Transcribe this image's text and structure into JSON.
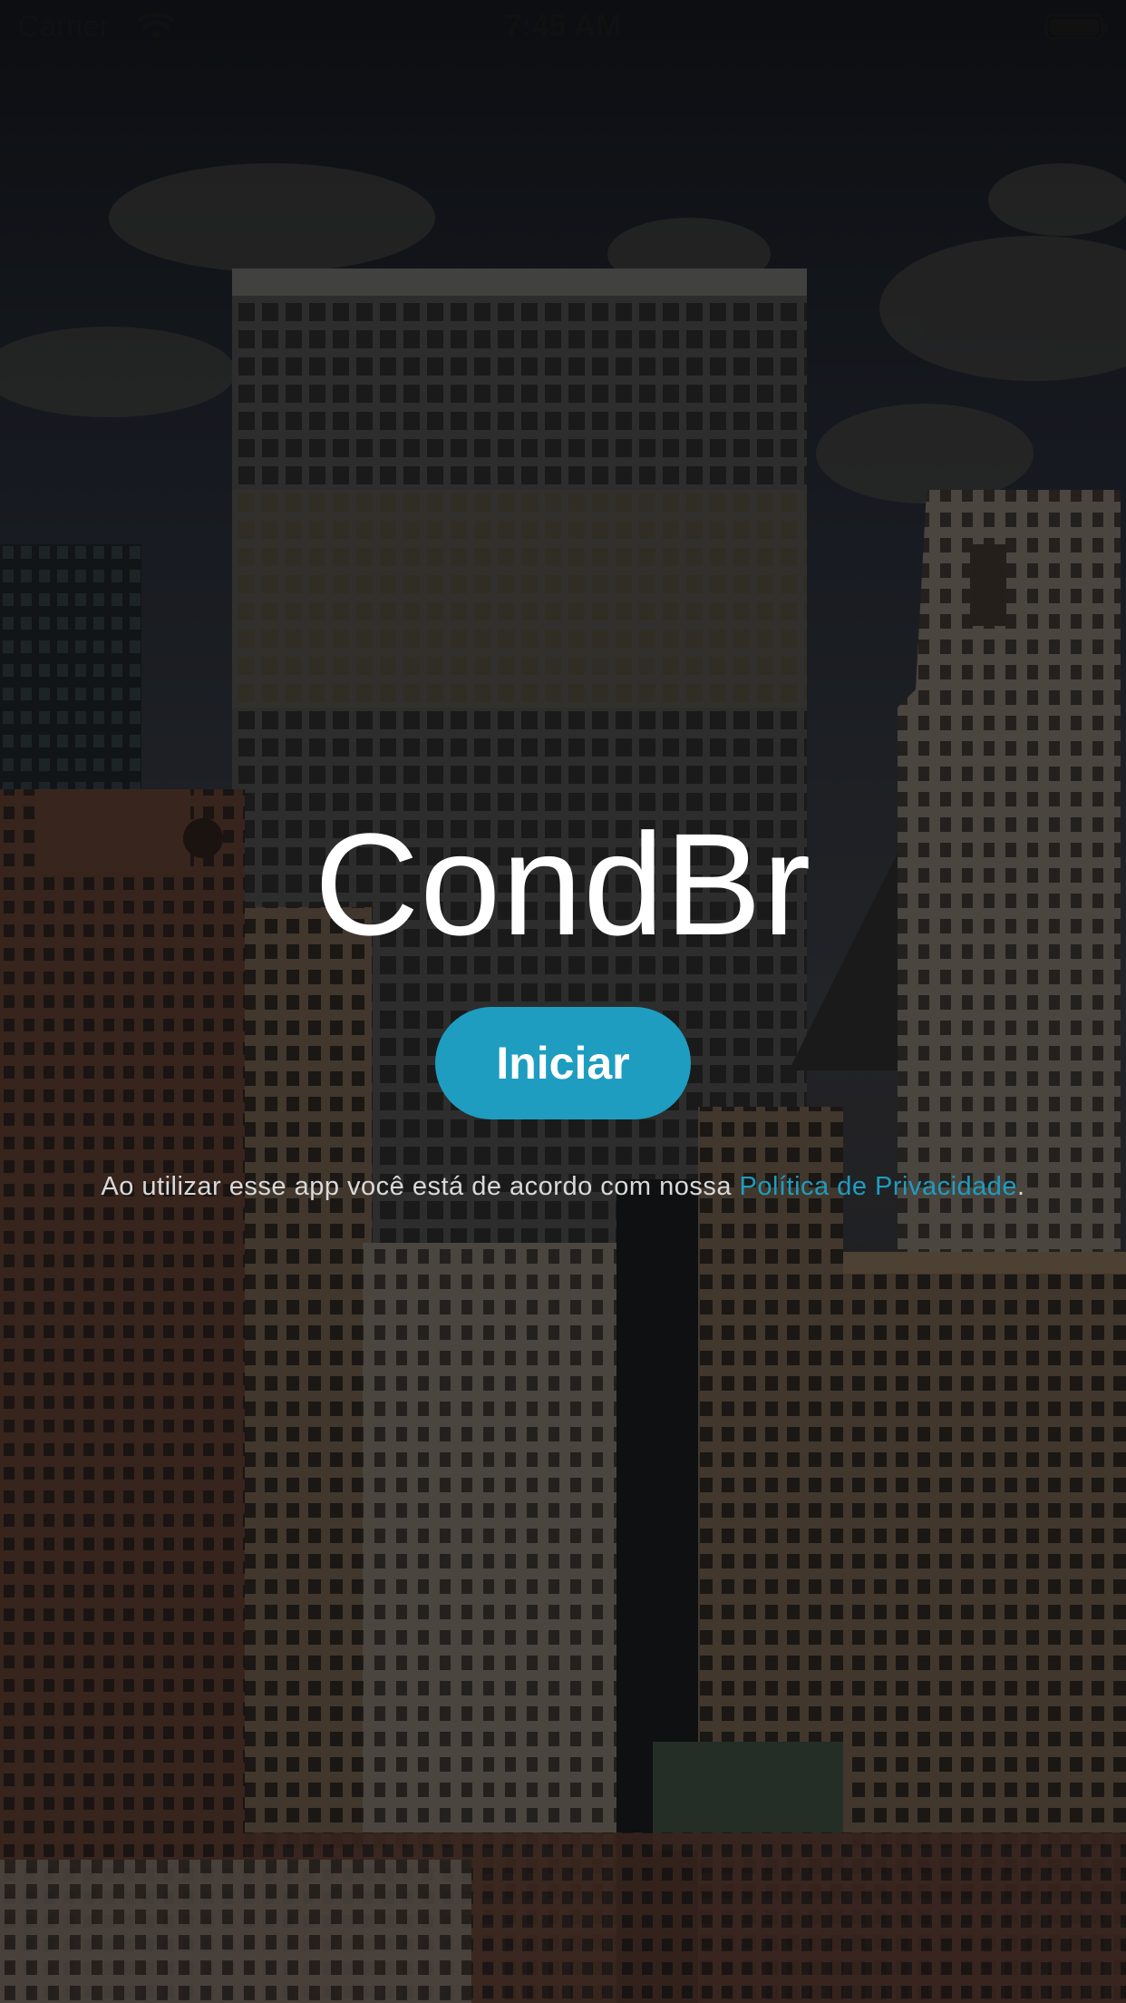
{
  "status_bar": {
    "carrier": "Carrier",
    "time": "7:45 AM",
    "wifi_icon": "wifi-icon",
    "battery_icon": "battery-icon"
  },
  "app": {
    "name": "CondBr",
    "start_button_label": "Iniciar",
    "accent_color": "#1e9dc0"
  },
  "privacy": {
    "prefix": "Ao utilizar esse app você está de acordo com nossa ",
    "link_label": "Política de Privacidade",
    "suffix": "."
  },
  "background": {
    "image": "city-skyline-background"
  }
}
